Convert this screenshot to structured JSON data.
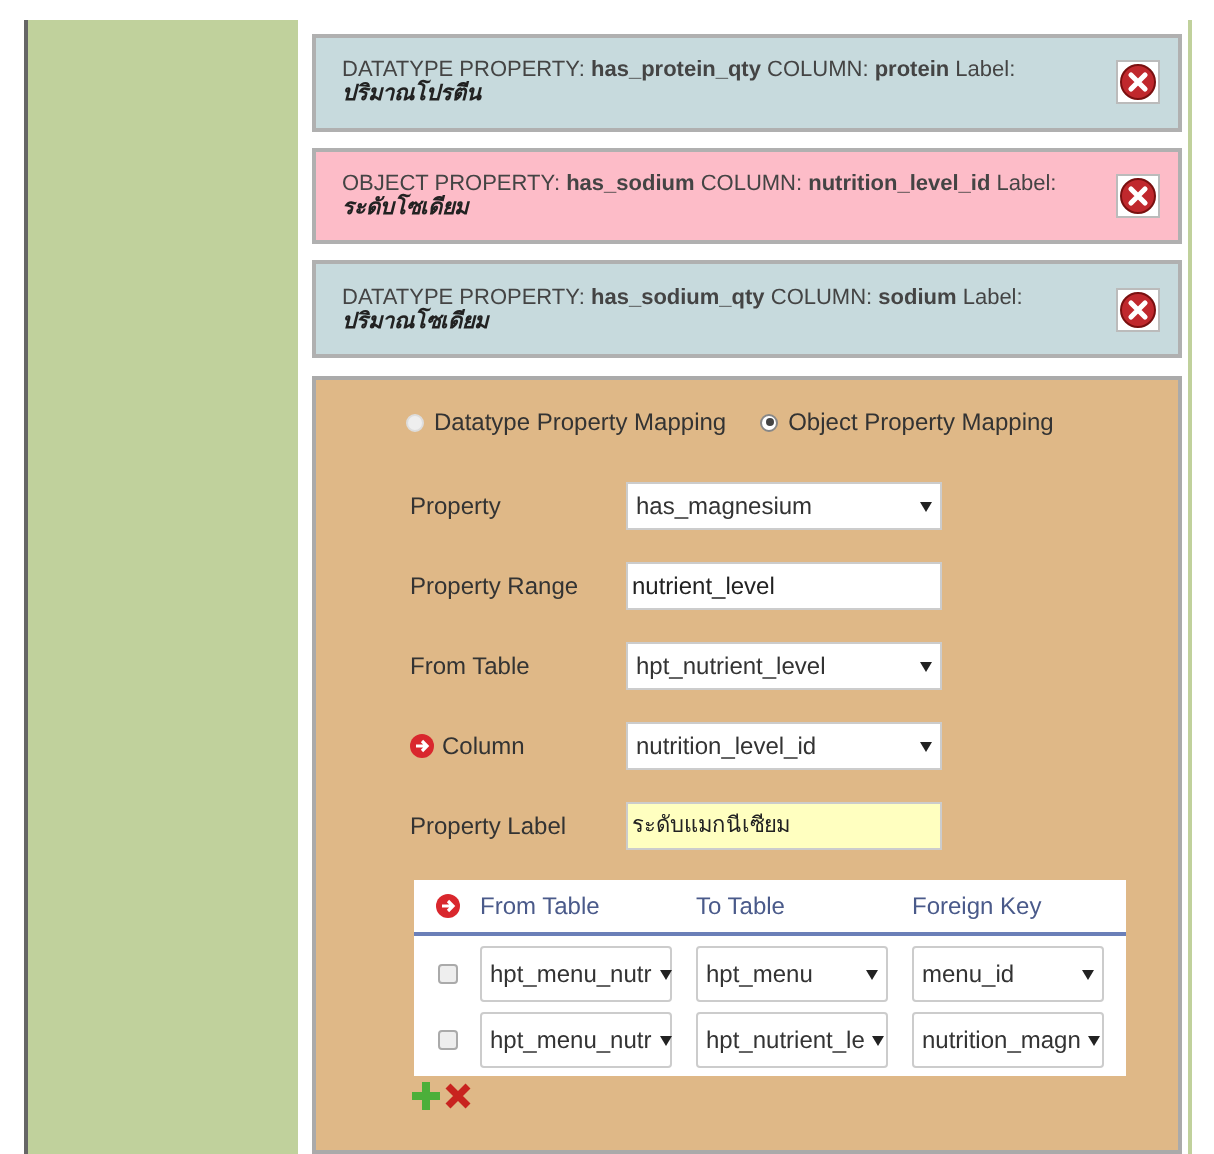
{
  "mappings": [
    {
      "kind": "datatype",
      "text": "DATATYPE PROPERTY: **has_protein_qty** COLUMN: **protein** Label:",
      "label": "ปริมาณโปรตีน"
    },
    {
      "kind": "object",
      "text": "OBJECT PROPERTY: **has_sodium** COLUMN: **nutrition_level_id** Label:",
      "label": "ระดับโซเดียม"
    },
    {
      "kind": "datatype",
      "text": "DATATYPE PROPERTY: **has_sodium_qty** COLUMN: **sodium** Label:",
      "label": "ปริมาณโซเดียม"
    }
  ],
  "form": {
    "mapping_types": [
      {
        "label": "Datatype Property Mapping",
        "selected": false
      },
      {
        "label": "Object Property Mapping",
        "selected": true
      }
    ],
    "fields": [
      {
        "kind": "select",
        "label": "Property",
        "value": "has_magnesium"
      },
      {
        "kind": "input",
        "label": "Property Range",
        "value": "nutrient_level"
      },
      {
        "kind": "select",
        "label": "From Table",
        "value": "hpt_nutrient_level"
      },
      {
        "kind": "select-marked",
        "label": "Column",
        "value": "nutrition_level_id"
      },
      {
        "kind": "highlighted-input",
        "label": "Property Label",
        "value": "ระดับแมกนีเซียม"
      }
    ],
    "join_table": {
      "columns": [
        "From Table",
        "To Table",
        "Foreign Key"
      ],
      "rows": [
        {
          "checked": false,
          "cells": [
            "hpt_menu_nutr",
            "hpt_menu",
            "menu_id"
          ]
        },
        {
          "checked": false,
          "cells": [
            "hpt_menu_nutr",
            "hpt_nutrient_le",
            "nutrition_magn"
          ]
        }
      ]
    }
  }
}
